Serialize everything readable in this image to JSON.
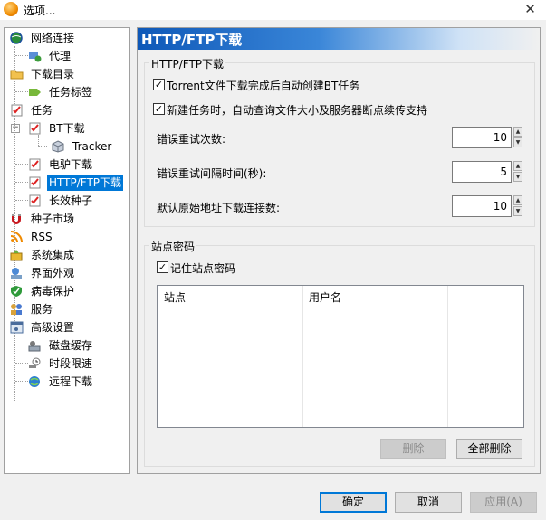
{
  "window": {
    "title": "选项...",
    "close_glyph": "✕"
  },
  "tree": {
    "items": [
      {
        "label": "网络连接",
        "icon": "network-icon"
      },
      {
        "label": "代理",
        "icon": "proxy-icon"
      },
      {
        "label": "下载目录",
        "icon": "folder-icon"
      },
      {
        "label": "任务标签",
        "icon": "tag-icon"
      },
      {
        "label": "任务",
        "icon": "task-icon"
      },
      {
        "label": "BT下载",
        "icon": "task-icon"
      },
      {
        "label": "Tracker",
        "icon": "cube-icon"
      },
      {
        "label": "电驴下载",
        "icon": "task-icon"
      },
      {
        "label": "HTTP/FTP下载",
        "icon": "task-icon",
        "selected": true
      },
      {
        "label": "长效种子",
        "icon": "task-icon"
      },
      {
        "label": "种子市场",
        "icon": "magnet-icon"
      },
      {
        "label": "RSS",
        "icon": "rss-icon"
      },
      {
        "label": "系统集成",
        "icon": "integration-icon"
      },
      {
        "label": "界面外观",
        "icon": "appearance-icon"
      },
      {
        "label": "病毒保护",
        "icon": "shield-icon"
      },
      {
        "label": "服务",
        "icon": "service-icon"
      },
      {
        "label": "高级设置",
        "icon": "advanced-icon"
      },
      {
        "label": "磁盘缓存",
        "icon": "disk-cache-icon"
      },
      {
        "label": "时段限速",
        "icon": "schedule-icon"
      },
      {
        "label": "远程下载",
        "icon": "remote-icon"
      }
    ]
  },
  "panel": {
    "header": "HTTP/FTP下载",
    "group1": {
      "title": "HTTP/FTP下载",
      "checkbox1": {
        "label": "Torrent文件下载完成后自动创建BT任务",
        "checked": true
      },
      "checkbox2": {
        "label": "新建任务时，自动查询文件大小及服务器断点续传支持",
        "checked": true
      },
      "retry_count": {
        "label": "错误重试次数:",
        "value": "10"
      },
      "retry_interval": {
        "label": "错误重试间隔时间(秒):",
        "value": "5"
      },
      "origin_connections": {
        "label": "默认原始地址下载连接数:",
        "value": "10"
      }
    },
    "group2": {
      "title": "站点密码",
      "remember": {
        "label": "记住站点密码",
        "checked": true
      },
      "columns": [
        "站点",
        "用户名"
      ],
      "delete_label": "删除",
      "delete_all_label": "全部删除"
    }
  },
  "footer": {
    "ok": "确定",
    "cancel": "取消",
    "apply": "应用(A)"
  },
  "glyphs": {
    "check": "✓",
    "up": "▲",
    "down": "▼",
    "minus": "−"
  },
  "colors": {
    "selection": "#0078d7",
    "header_gradient_start": "#0e58b8"
  }
}
